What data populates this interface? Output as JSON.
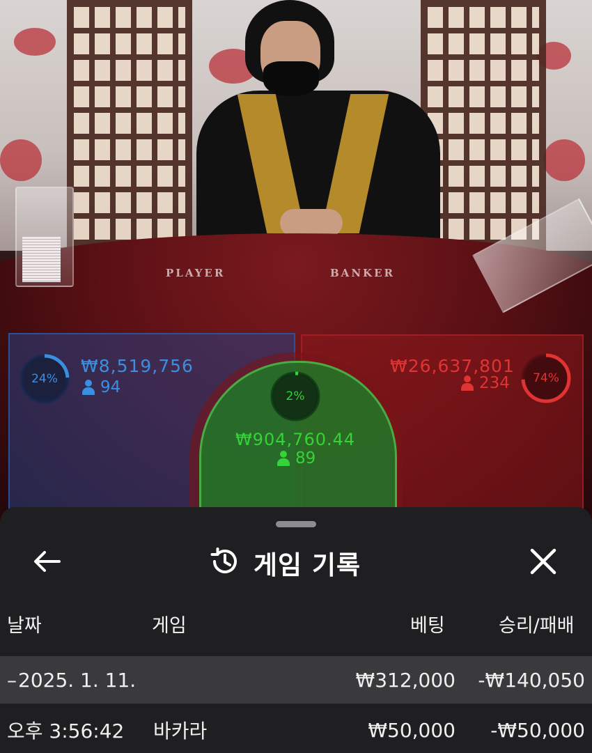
{
  "stream": {
    "felt_labels": {
      "player": "PLAYER",
      "banker": "BANKER"
    }
  },
  "bets": {
    "player": {
      "percent": "24%",
      "percent_value": 24,
      "amount": "₩8,519,756",
      "players": "94",
      "color": "#3a8fe0"
    },
    "tie": {
      "percent": "2%",
      "percent_value": 2,
      "amount": "₩904,760.44",
      "players": "89",
      "color": "#35d23a"
    },
    "banker": {
      "percent": "74%",
      "percent_value": 74,
      "amount": "₩26,637,801",
      "players": "234",
      "color": "#e03434"
    }
  },
  "sheet": {
    "title": "게임 기록",
    "icons": {
      "back": "arrow-left-icon",
      "history": "history-icon",
      "close": "close-icon"
    },
    "columns": {
      "date": "날짜",
      "game": "게임",
      "bet": "베팅",
      "result": "승리/패배"
    },
    "date_group": {
      "toggle": "–",
      "date": "2025. 1. 11.",
      "bet_total": "₩312,000",
      "result_total": "-₩140,050"
    },
    "rows": [
      {
        "time": "오후 3:56:42",
        "game": "바카라",
        "bet": "₩50,000",
        "result": "-₩50,000"
      }
    ]
  }
}
